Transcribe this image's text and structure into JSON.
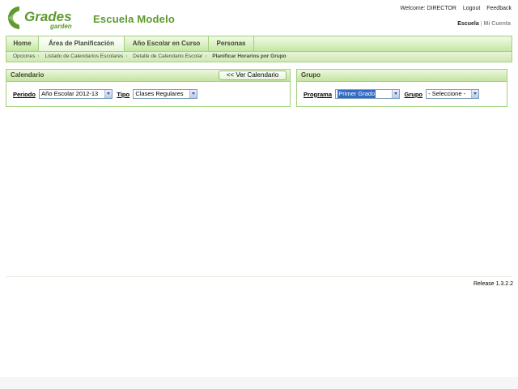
{
  "brand": {
    "logo_word_1": "Grades",
    "logo_word_2": "garden",
    "school_name": "Escuela Modelo",
    "green": "#5e9a2d"
  },
  "top_links": {
    "welcome": "Welcome: DIRECTOR",
    "logout": "Logout",
    "feedback": "Feedback"
  },
  "account_links": {
    "school": "Escuela",
    "separator": "|",
    "my_account": "Mi Cuenta"
  },
  "nav": {
    "tabs": [
      {
        "label": "Home"
      },
      {
        "label": "Área de Planificación"
      },
      {
        "label": "Año Escolar en Curso"
      },
      {
        "label": "Personas"
      }
    ]
  },
  "breadcrumb": [
    "Opciones",
    "Listado de Calendarios Escolares",
    "Detalle de Calendario Escolar",
    "Planificar Horarios por Grupo"
  ],
  "calendar_panel": {
    "title": "Calendario",
    "view_button": "<< Ver Calendario",
    "period_label": "Periodo",
    "period_value": "Año Escolar 2012-13",
    "type_label": "Tipo",
    "type_value": "Clases Regulares"
  },
  "group_panel": {
    "title": "Grupo",
    "program_label": "Programa",
    "program_value": "Primer Grado",
    "group_label": "Grupo",
    "group_value": "- Seleccione -"
  },
  "footer": {
    "release": "Release 1.3.2.2"
  }
}
